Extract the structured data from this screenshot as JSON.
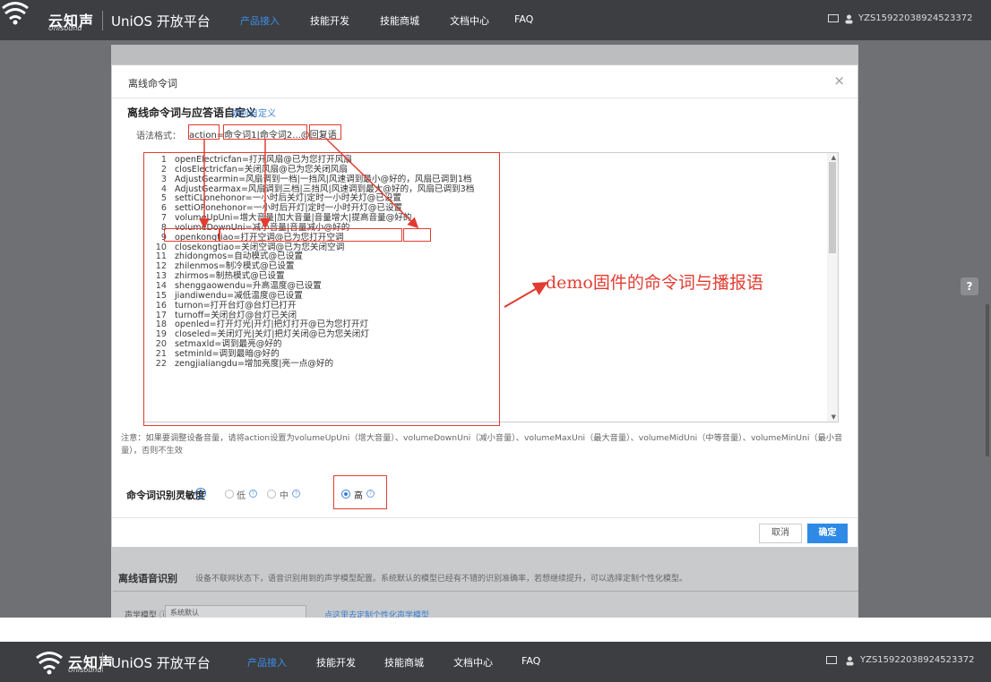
{
  "nav": {
    "logo_cn": "云知声",
    "logo_en": "Unisound",
    "platform": "UniOS 开放平台",
    "menu": [
      "产品接入",
      "技能开发",
      "技能商城",
      "文档中心",
      "FAQ"
    ],
    "active_index": 0,
    "user": "YZS15922038924523372"
  },
  "background": {
    "section_title": "离线语音识别",
    "section_desc": "设备不联网状态下，语音识别用到的声学模型配置。系统默认的模型已经有不错的识别准确率，若想继续提升，可以选择定制个性化模型。",
    "model_label": "声学模型 ⓘ ：",
    "model_value": "系统默认",
    "model_link": "点这里去定制个性化声学模型"
  },
  "modal": {
    "title": "离线命令词",
    "close": "×",
    "section_title": "离线命令词与应答语自定义",
    "section_link": "如何自定义",
    "syntax_label": "语法格式：",
    "syntax": "action=命令词1|命令词2...@回复语",
    "code_lines": [
      "openElectricfan=打开风扇@已为您打开风扇",
      "closElectricfan=关闭风扇@已为您关闭风扇",
      "AdjustGearmin=风扇调到一档|一挡风|风速调到最小@好的，风扇已调到1档",
      "AdjustGearmax=风扇调到三档|三挡风|风速调到最大@好的，风扇已调到3档",
      "settiCLonehonor=一小时后关灯|定时一小时关灯@已设置",
      "settiOPonehonor=一小时后开灯|定时一小时开灯@已设置",
      "volumeUpUni=增大音量|加大音量|音量增大|提高音量@好的",
      "volumeDownUni=减小音量|音量减小@好的",
      "openkongtiao=打开空调@已为您打开空调",
      "closekongtiao=关闭空调@已为您关闭空调",
      "zhidongmos=自动模式@已设置",
      "zhilenmos=制冷模式@已设置",
      "zhirmos=制热模式@已设置",
      "shenggaowendu=升高温度@已设置",
      "jiandiwendu=减低温度@已设置",
      "turnon=打开台灯@台灯已打开",
      "turnoff=关闭台灯@台灯已关闭",
      "openled=打开灯光|开灯|把灯打开@已为您打开灯",
      "closeled=关闭灯光|关灯|把灯关闭@已为您关闭灯",
      "setmaxld=调到最亮@好的",
      "setminld=调到最暗@好的",
      "zengjialiangdu=增加亮度|亮一点@好的"
    ],
    "annotation": "demo固件的命令词与播报语",
    "note": "注意：如果要调整设备音量，请将action设置为volumeUpUni（增大音量）、volumeDownUni（减小音量）、volumeMaxUni（最大音量）、volumeMidUni（中等音量）、volumeMinUni（最小音量），否则不生效",
    "sensitivity_title": "命令词识别灵敏度",
    "sensitivity_options": [
      "低",
      "中",
      "高"
    ],
    "sensitivity_selected": "高",
    "cancel": "取消",
    "ok": "确定",
    "help_icon": "?"
  },
  "colors": {
    "nav_bg": "#3c3e42",
    "accent": "#2e8ae6",
    "highlight": "#e23c32"
  }
}
